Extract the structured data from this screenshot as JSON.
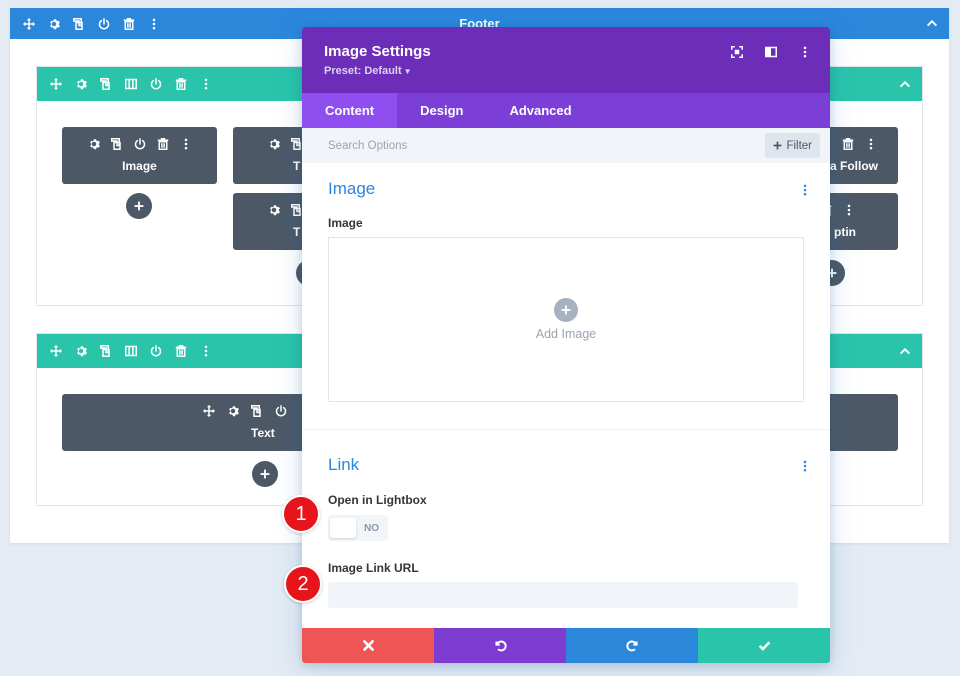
{
  "section": {
    "title": "Footer",
    "color": "#2b87da"
  },
  "row_color": "#29c4a9",
  "module_color": "#4c5866",
  "modules": {
    "image": "Image",
    "text_partial_1": "T",
    "text_partial_2": "T",
    "social_partial": "a Follow",
    "optin_partial": "ptin",
    "text": "Text"
  },
  "modal": {
    "title": "Image Settings",
    "preset": "Preset: Default",
    "tabs": [
      "Content",
      "Design",
      "Advanced"
    ],
    "active_tab": "Content",
    "search_placeholder": "Search Options",
    "filter_label": "Filter",
    "image_group": {
      "title": "Image",
      "field_label": "Image",
      "upload_text": "Add Image"
    },
    "link_group": {
      "title": "Link",
      "lightbox_label": "Open in Lightbox",
      "lightbox_value": "NO",
      "url_label": "Image Link URL",
      "url_value": ""
    },
    "footer_colors": {
      "cancel": "#ef5555",
      "undo": "#7e3bd0",
      "redo": "#2b87da",
      "save": "#29c4a9"
    }
  },
  "badges": [
    "1",
    "2"
  ],
  "icons": [
    "move-icon",
    "gear-icon",
    "duplicate-icon",
    "columns-icon",
    "power-icon",
    "trash-icon",
    "kebab-icon",
    "chevron-up-icon",
    "plus-icon",
    "expand-icon",
    "split-view-icon",
    "close-icon",
    "undo-icon",
    "redo-icon",
    "check-icon"
  ]
}
